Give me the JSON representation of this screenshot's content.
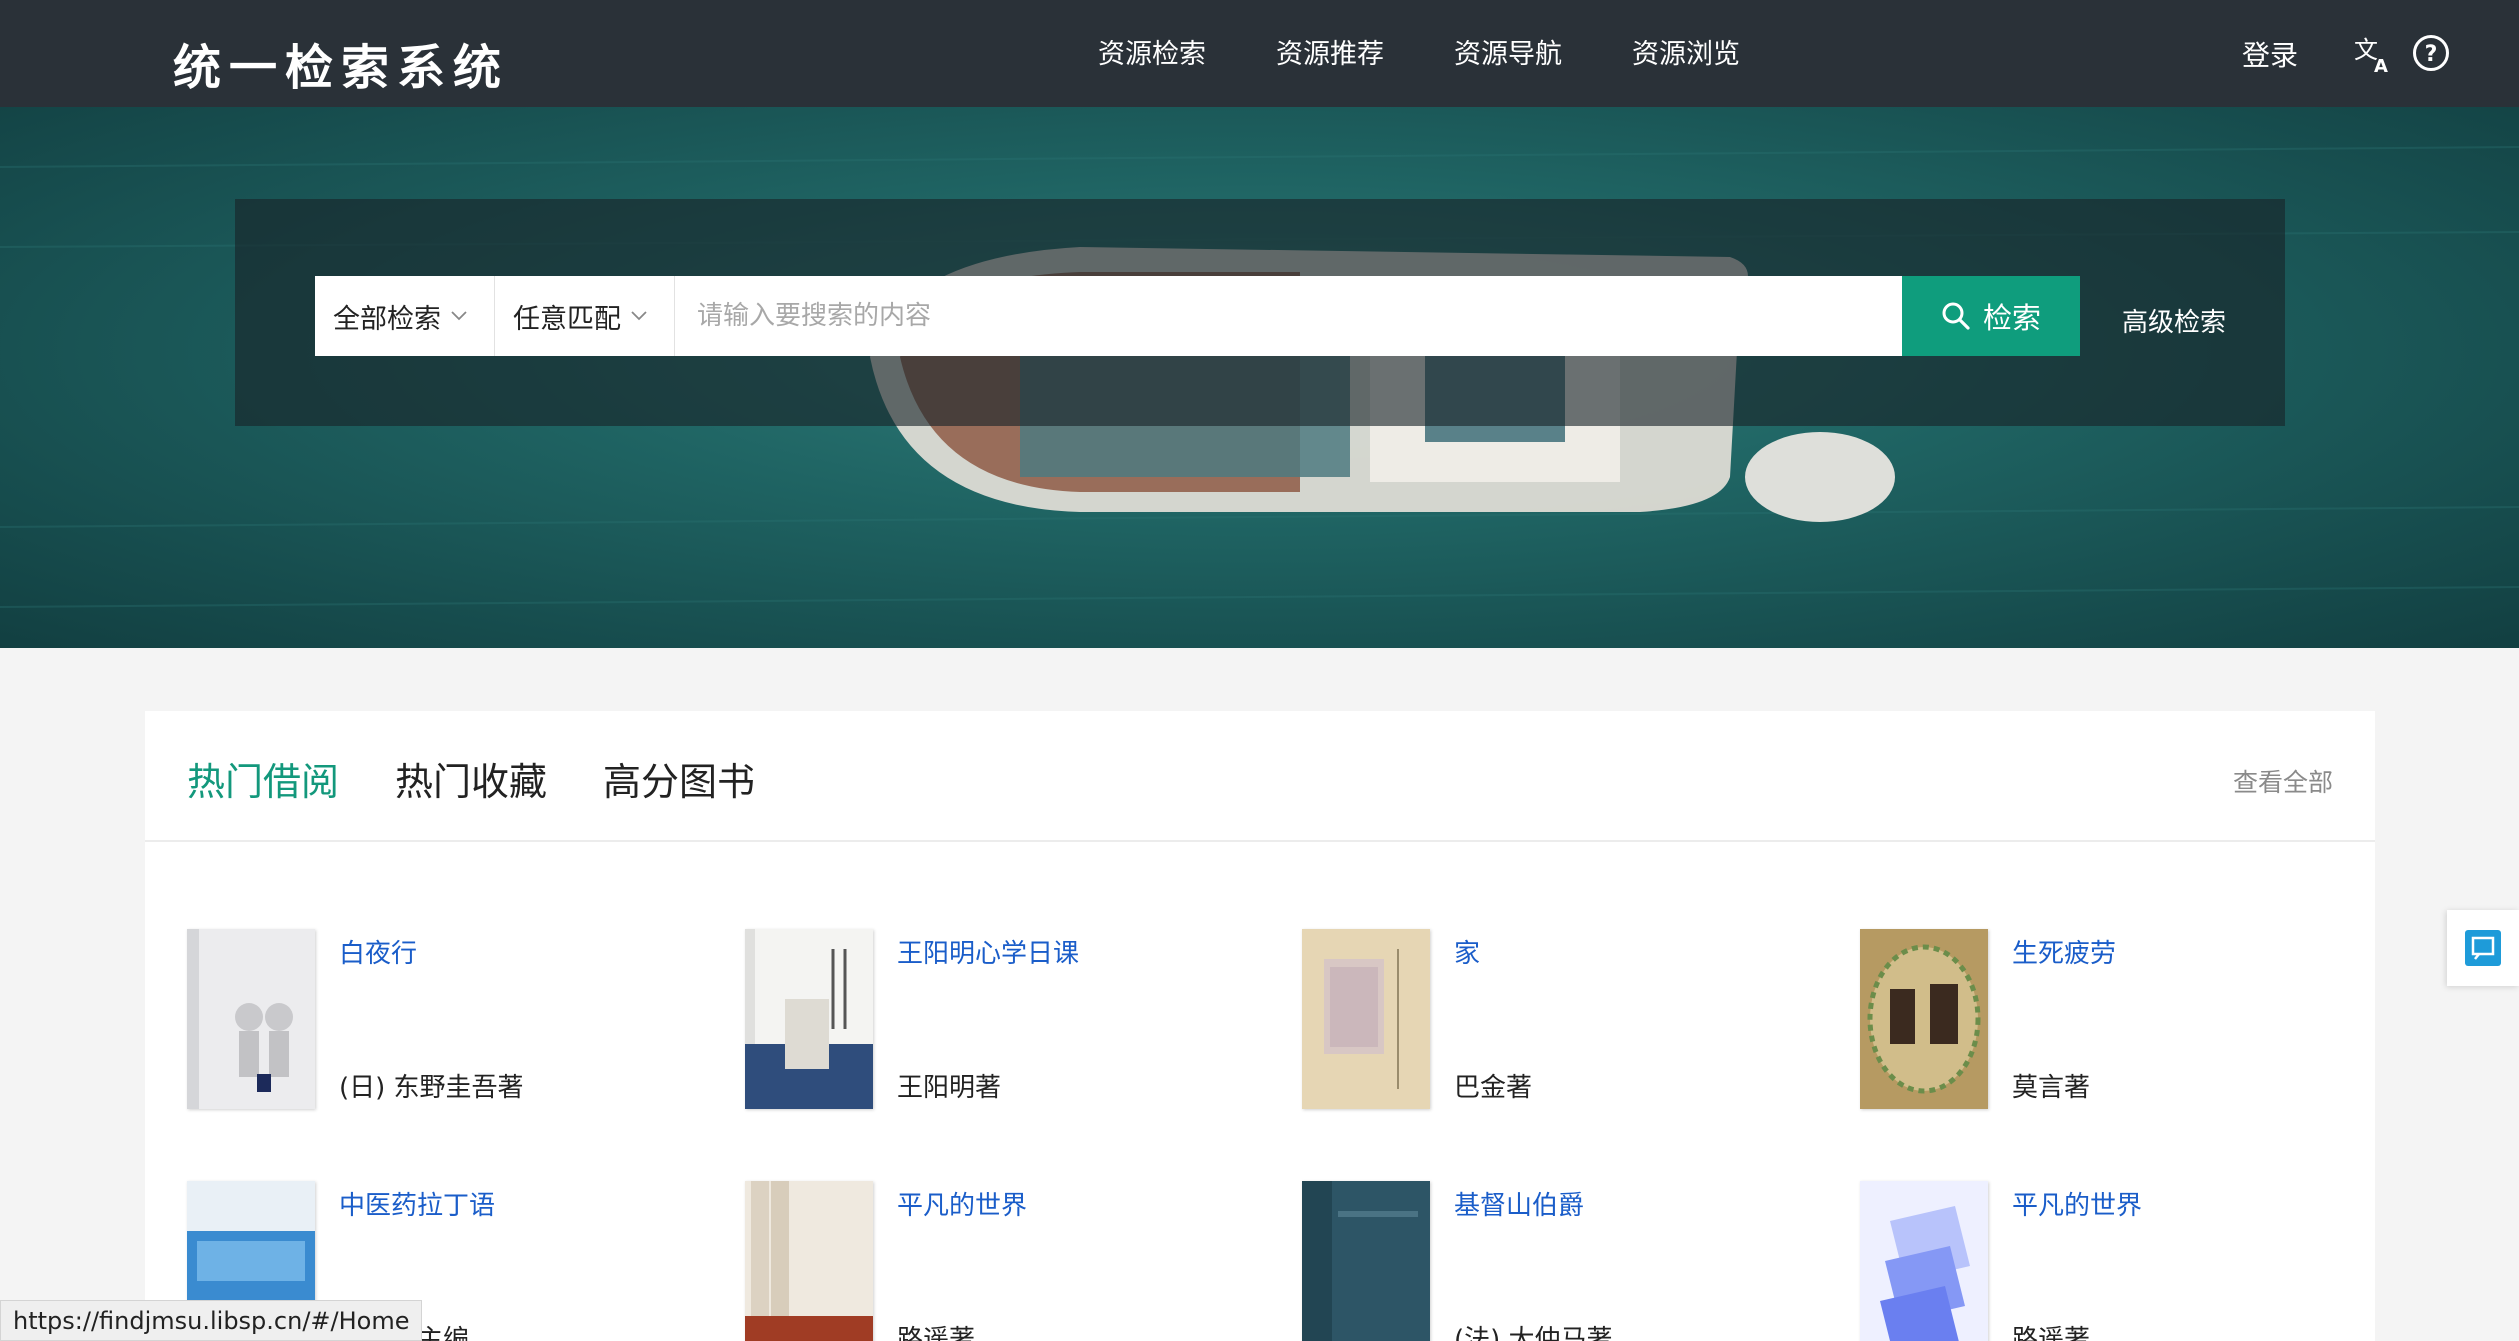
{
  "header": {
    "logo": "统一检索系统",
    "nav": [
      "资源检索",
      "资源推荐",
      "资源导航",
      "资源浏览"
    ],
    "login": "登录"
  },
  "search": {
    "scope": "全部检索",
    "match": "任意匹配",
    "placeholder": "请输入要搜索的内容",
    "button": "检索",
    "advanced": "高级检索"
  },
  "panel": {
    "tabs": [
      "热门借阅",
      "热门收藏",
      "高分图书"
    ],
    "active_tab": "热门借阅",
    "view_all": "查看全部"
  },
  "books": [
    {
      "title": "白夜行",
      "author": "(日) 东野圭吾著",
      "cover_color": "#e9eaec"
    },
    {
      "title": "王阳明心学日课",
      "author": "王阳明著",
      "cover_color": "#f3f3f1"
    },
    {
      "title": "家",
      "author": "巴金著",
      "cover_color": "#e3d3b0"
    },
    {
      "title": "生死疲劳",
      "author": "莫言著",
      "cover_color": "#b8a06a"
    },
    {
      "title": "中医药拉丁语",
      "author": "刘春玲主编",
      "cover_color": "#3d8fd1"
    },
    {
      "title": "平凡的世界",
      "author": "路遥著",
      "cover_color": "#f1ece4"
    },
    {
      "title": "基督山伯爵",
      "author": "(法) 大仲马著",
      "cover_color": "#2d5566"
    },
    {
      "title": "平凡的世界",
      "author": "路遥著",
      "cover_color": "#c8d4fb"
    }
  ],
  "status_bar": {
    "url": "https://findjmsu.libsp.cn/#/Home"
  }
}
